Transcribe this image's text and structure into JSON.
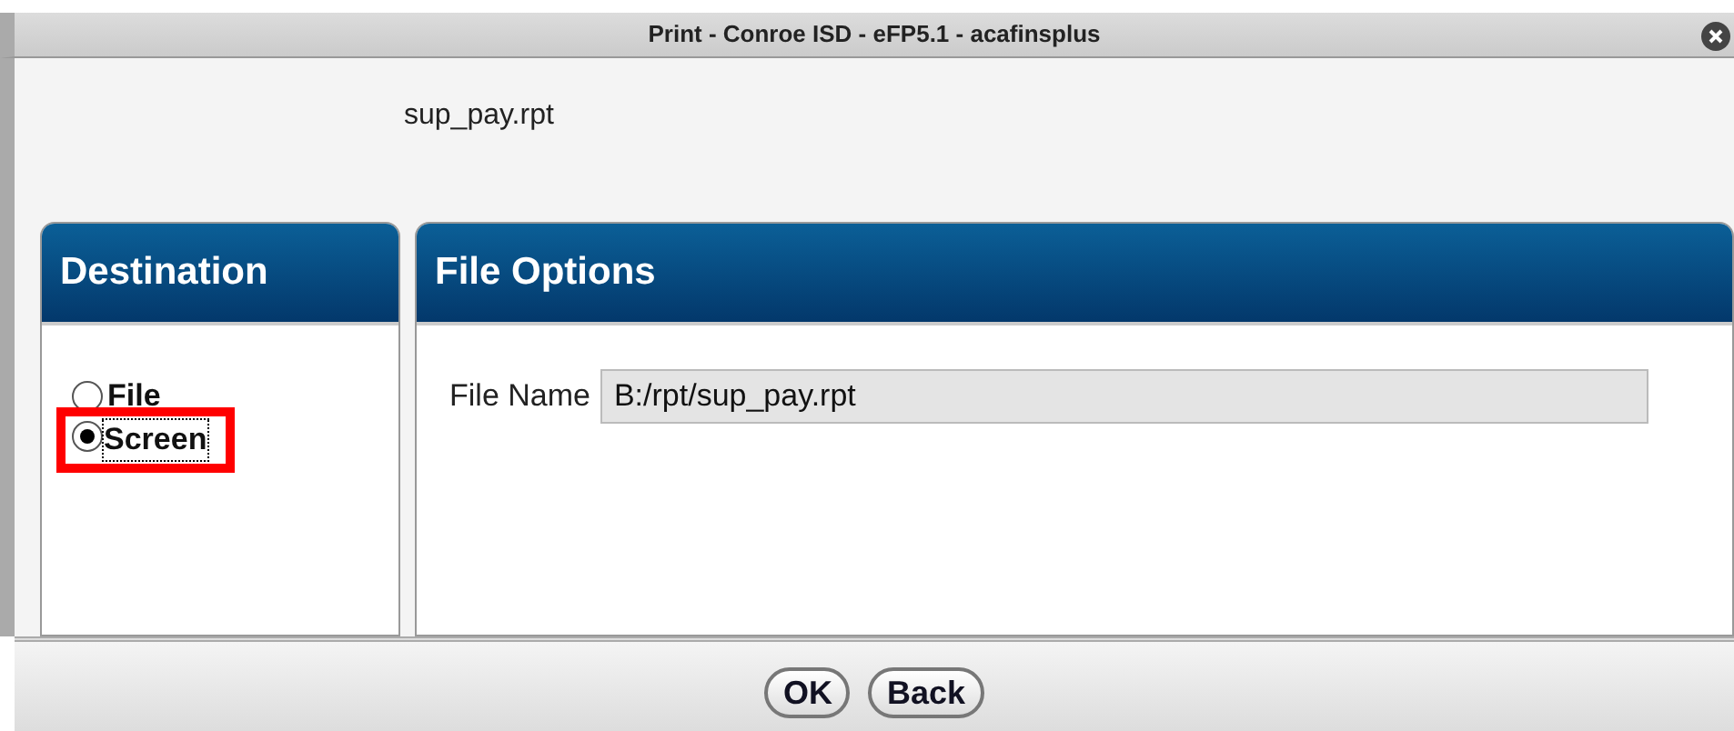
{
  "window": {
    "title": "Print - Conroe ISD - eFP5.1 - acafinsplus"
  },
  "report_name": "sup_pay.rpt",
  "destination": {
    "title": "Destination",
    "options": [
      {
        "label": "File",
        "selected": false,
        "highlighted": false
      },
      {
        "label": "Screen",
        "selected": true,
        "highlighted": true
      }
    ]
  },
  "file_options": {
    "title": "File Options",
    "field_label": "File Name",
    "field_value": "B:/rpt/sup_pay.rpt"
  },
  "buttons": [
    "OK",
    "Back"
  ]
}
